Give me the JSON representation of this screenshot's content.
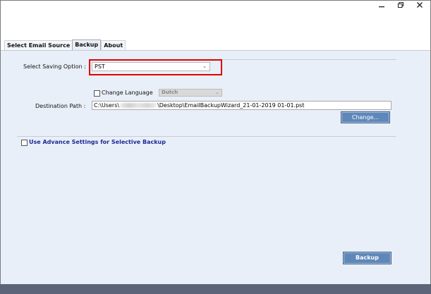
{
  "window": {
    "minimize_glyph": "—",
    "maximize_glyph": "❐",
    "close_glyph": "✕"
  },
  "tabs": [
    {
      "label": "Select Email Source",
      "active": false
    },
    {
      "label": "Backup",
      "active": true
    },
    {
      "label": "About",
      "active": false
    }
  ],
  "backup": {
    "saving_option_label": "Select Saving Option :",
    "saving_option_value": "PST",
    "change_language_label": "Change Language",
    "change_language_checked": false,
    "language_value": "Dutch",
    "destination_label": "Destination Path :",
    "destination_prefix": "C:\\Users\\",
    "destination_suffix": "\\Desktop\\EmailBackupWizard_21-01-2019 01-01.pst",
    "change_button": "Change...",
    "advance_label": "Use Advance Settings for Selective Backup",
    "advance_checked": false,
    "backup_button": "Backup"
  },
  "colors": {
    "highlight": "#e00000",
    "button": "#5f87b9",
    "panel": "#e9eff8",
    "link_text": "#1d2a96"
  }
}
